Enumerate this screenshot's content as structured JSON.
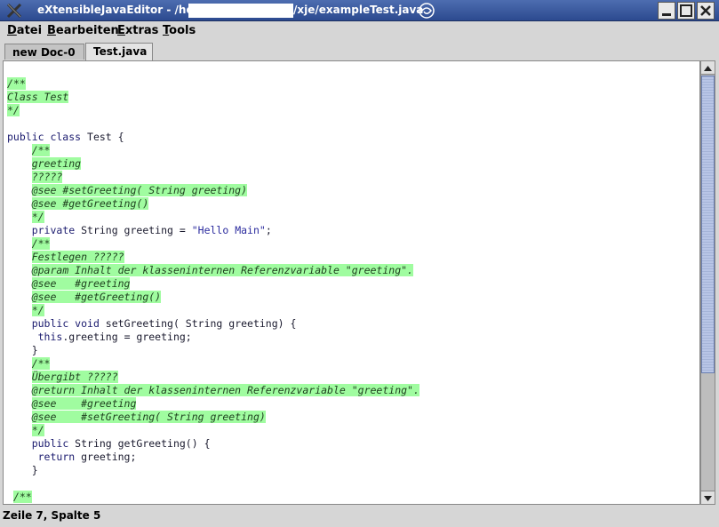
{
  "window": {
    "title_prefix": "eXtensibleJavaEditor - /home/",
    "title_suffix": "/xje/exampleTest.java",
    "colors": {
      "titlebar": "#3a5ba0",
      "highlight": "#a0fca0"
    }
  },
  "menu": {
    "items": [
      {
        "label": "Datei",
        "mnemonic": "D",
        "rest": "atei"
      },
      {
        "label": "Bearbeiten",
        "mnemonic": "B",
        "rest": "earbeiten"
      },
      {
        "label": "Extras",
        "mnemonic": "E",
        "rest": "xtras"
      },
      {
        "label": "Tools",
        "mnemonic": "T",
        "rest": "ools"
      }
    ]
  },
  "tabs": [
    {
      "label": "new Doc-0",
      "active": false
    },
    {
      "label": "Test.java",
      "active": true
    }
  ],
  "code": {
    "lines": [
      {
        "indent": "",
        "hl": "/**"
      },
      {
        "indent": "",
        "hl": "Class Test"
      },
      {
        "indent": "",
        "hl": "*/"
      },
      {
        "indent": "",
        "text": ""
      },
      {
        "indent": "",
        "kw": "public class",
        "text": " Test {"
      },
      {
        "indent": "    ",
        "hl": "/**"
      },
      {
        "indent": "    ",
        "hl": "greeting"
      },
      {
        "indent": "    ",
        "hl": "?????"
      },
      {
        "indent": "    ",
        "hl": "@see #setGreeting( String greeting)"
      },
      {
        "indent": "    ",
        "hl": "@see #getGreeting()"
      },
      {
        "indent": "    ",
        "hl": "*/"
      },
      {
        "indent": "    ",
        "kw": "private",
        "text": " String greeting = ",
        "str": "\"Hello Main\"",
        "tail": ";"
      },
      {
        "indent": "    ",
        "hl": "/**"
      },
      {
        "indent": "    ",
        "hl": "Festlegen ?????"
      },
      {
        "indent": "    ",
        "hl": "@param Inhalt der klasseninternen Referenzvariable \"greeting\"."
      },
      {
        "indent": "    ",
        "hl": "@see   #greeting"
      },
      {
        "indent": "    ",
        "hl": "@see   #getGreeting()"
      },
      {
        "indent": "    ",
        "hl": "*/"
      },
      {
        "indent": "    ",
        "kw": "public void",
        "text": " setGreeting( String greeting) {"
      },
      {
        "indent": "     ",
        "kw": "this",
        "text": ".greeting = greeting;"
      },
      {
        "indent": "    ",
        "text": "}"
      },
      {
        "indent": "    ",
        "hl": "/**"
      },
      {
        "indent": "    ",
        "hl": "Übergibt ?????"
      },
      {
        "indent": "    ",
        "hl": "@return Inhalt der klasseninternen Referenzvariable \"greeting\"."
      },
      {
        "indent": "    ",
        "hl": "@see    #greeting"
      },
      {
        "indent": "    ",
        "hl": "@see    #setGreeting( String greeting)"
      },
      {
        "indent": "    ",
        "hl": "*/"
      },
      {
        "indent": "    ",
        "kw": "public",
        "text": " String getGreeting() {"
      },
      {
        "indent": "     ",
        "kw": "return",
        "text": " greeting;"
      },
      {
        "indent": "    ",
        "text": "}"
      },
      {
        "indent": "",
        "text": ""
      },
      {
        "indent": " ",
        "hl": "/**"
      }
    ]
  },
  "status": {
    "text": "Zeile 7, Spalte 5"
  }
}
